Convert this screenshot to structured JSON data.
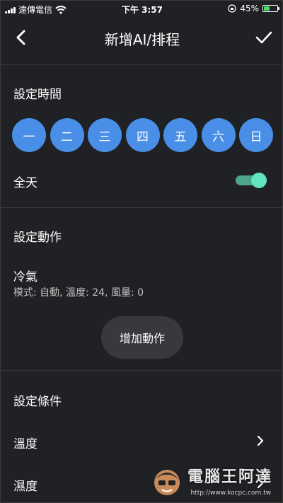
{
  "status": {
    "carrier": "遠傳電信",
    "time": "下午 3:57",
    "battery": "45%",
    "battery_level": 0.45
  },
  "nav": {
    "title": "新增AI/排程"
  },
  "schedule": {
    "title": "設定時間",
    "days": [
      "一",
      "二",
      "三",
      "四",
      "五",
      "六",
      "日"
    ],
    "all_day_label": "全天",
    "all_day_on": true
  },
  "actions": {
    "title": "設定動作",
    "item_name": "冷氣",
    "item_desc": "模式: 自動, 溫度: 24, 風量: 0",
    "add_label": "增加動作"
  },
  "conditions": {
    "title": "設定條件",
    "items": [
      "溫度",
      "濕度"
    ]
  },
  "watermark": {
    "text": "電腦王阿達",
    "url": "http://www.kocpc.com.tw"
  },
  "colors": {
    "background": "#202124",
    "day_button": "#4a8fe7",
    "toggle_on": "#64e3c1"
  }
}
